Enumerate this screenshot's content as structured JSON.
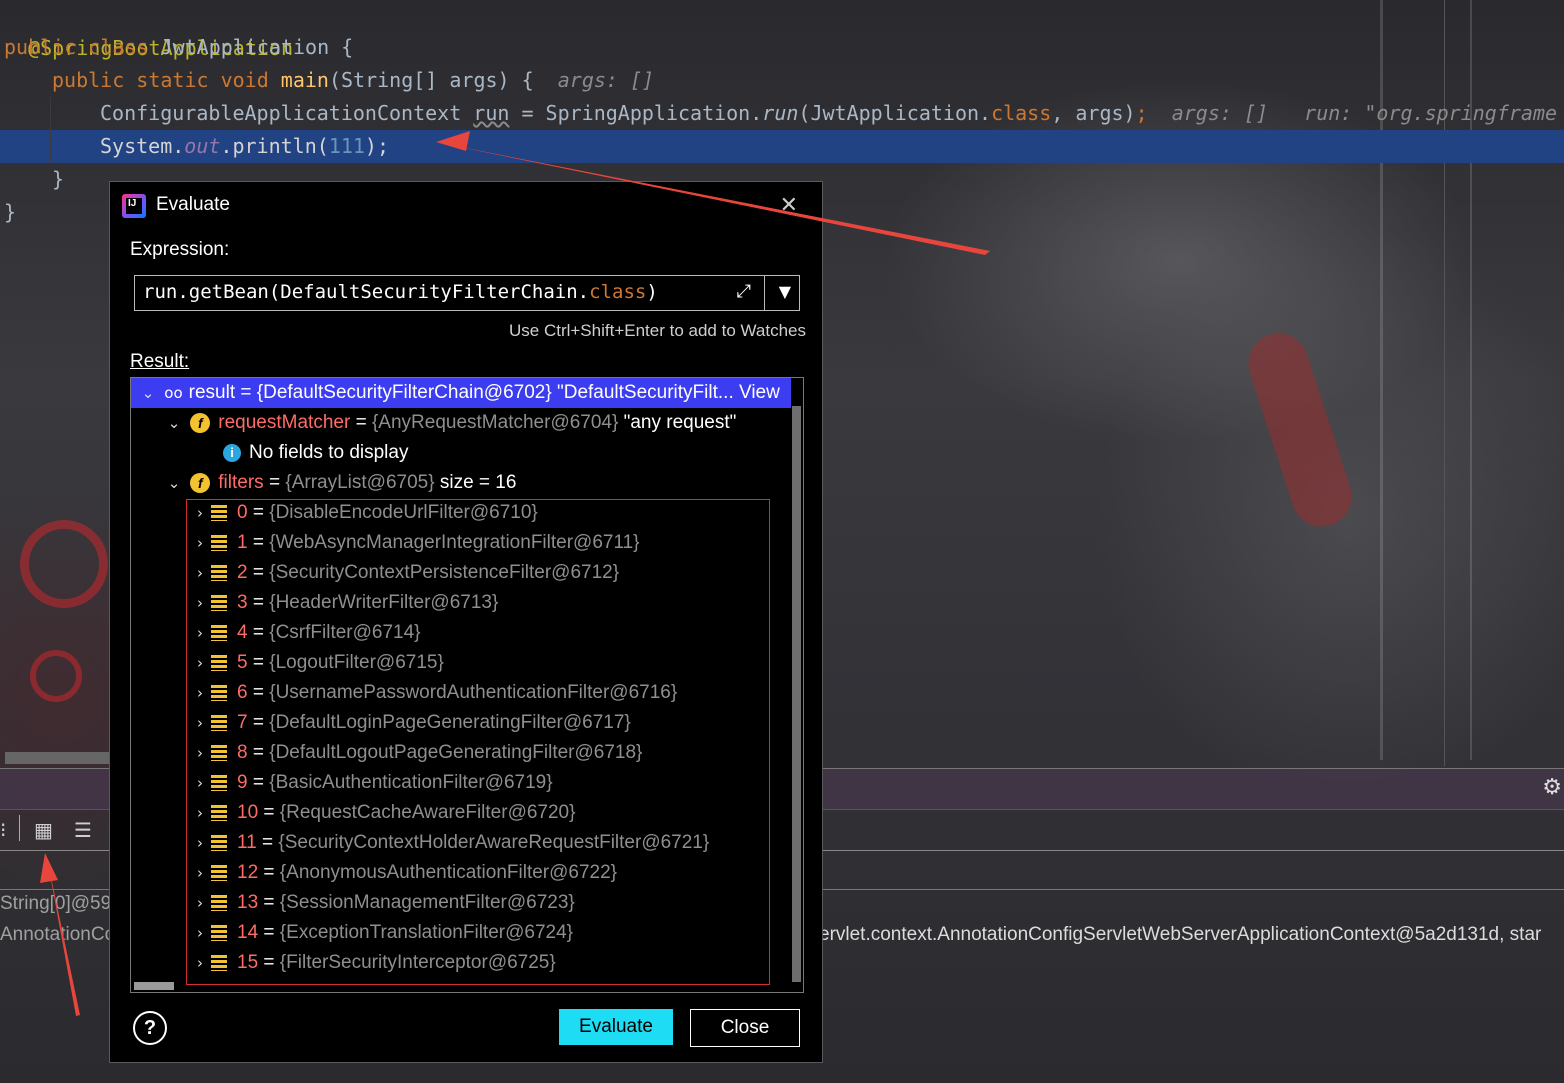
{
  "editor": {
    "lines": [
      {
        "annotation": "@SpringBootApplication"
      },
      {
        "kw": "public class ",
        "name": "JwtApplication {"
      },
      {
        "kw": "public static void ",
        "fn": "main",
        "rest": "(String[] args) {",
        "hint": "args: []"
      },
      {
        "type": "ConfigurableApplicationContext ",
        "var": "run",
        "mid": " = SpringApplication.",
        "call": "run",
        "args_open": "(JwtApplication.",
        "cls": "class",
        "args_close": ", args)",
        "semi": ";",
        "hint1": "args: []",
        "hint2": "run: \"org.springframe"
      },
      {
        "obj": "System.",
        "out": "out",
        "call": ".println(",
        "num": "111",
        "end": ");"
      },
      {
        "text": "}"
      },
      {
        "text": "}"
      }
    ]
  },
  "lower_panel": {
    "left_var_1": "String[0]@59",
    "left_var_2": "AnnotationCo",
    "right_value": "ervlet.context.AnnotationConfigServletWebServerApplicationContext@5a2d131d, star"
  },
  "dialog": {
    "title": "Evaluate",
    "logo_text": "IJ",
    "expression_label": "Expression:",
    "expression": {
      "prefix": "run.getBean(DefaultSecurityFilterChain.",
      "keyword": "class",
      "suffix": ")"
    },
    "hint": "Use Ctrl+Shift+Enter to add to Watches",
    "result_label": "Result:",
    "result": {
      "root": "result = {DefaultSecurityFilterChain@6702} \"DefaultSecurityFilt... View",
      "request_matcher": {
        "name": "requestMatcher",
        "eq": " = ",
        "type": "{AnyRequestMatcher@6704}",
        "value": " \"any request\""
      },
      "no_fields": "No fields to display",
      "filters": {
        "name": "filters",
        "eq": " = ",
        "type": "{ArrayList@6705}",
        "size": "  size = 16"
      },
      "items": [
        {
          "idx": "0",
          "val": "{DisableEncodeUrlFilter@6710}"
        },
        {
          "idx": "1",
          "val": "{WebAsyncManagerIntegrationFilter@6711}"
        },
        {
          "idx": "2",
          "val": "{SecurityContextPersistenceFilter@6712}"
        },
        {
          "idx": "3",
          "val": "{HeaderWriterFilter@6713}"
        },
        {
          "idx": "4",
          "val": "{CsrfFilter@6714}"
        },
        {
          "idx": "5",
          "val": "{LogoutFilter@6715}"
        },
        {
          "idx": "6",
          "val": "{UsernamePasswordAuthenticationFilter@6716}"
        },
        {
          "idx": "7",
          "val": "{DefaultLoginPageGeneratingFilter@6717}"
        },
        {
          "idx": "8",
          "val": "{DefaultLogoutPageGeneratingFilter@6718}"
        },
        {
          "idx": "9",
          "val": "{BasicAuthenticationFilter@6719}"
        },
        {
          "idx": "10",
          "val": "{RequestCacheAwareFilter@6720}"
        },
        {
          "idx": "11",
          "val": "{SecurityContextHolderAwareRequestFilter@6721}"
        },
        {
          "idx": "12",
          "val": "{AnonymousAuthenticationFilter@6722}"
        },
        {
          "idx": "13",
          "val": "{SessionManagementFilter@6723}"
        },
        {
          "idx": "14",
          "val": "{ExceptionTranslationFilter@6724}"
        },
        {
          "idx": "15",
          "val": "{FilterSecurityInterceptor@6725}"
        }
      ]
    },
    "help": "?",
    "evaluate_label": "Evaluate",
    "close_label": "Close"
  },
  "colors": {
    "selection": "#3c3cf0",
    "evaluate_button": "#1edcf3",
    "annotation_arrow": "#e8463c",
    "highlight_line": "#214283"
  }
}
